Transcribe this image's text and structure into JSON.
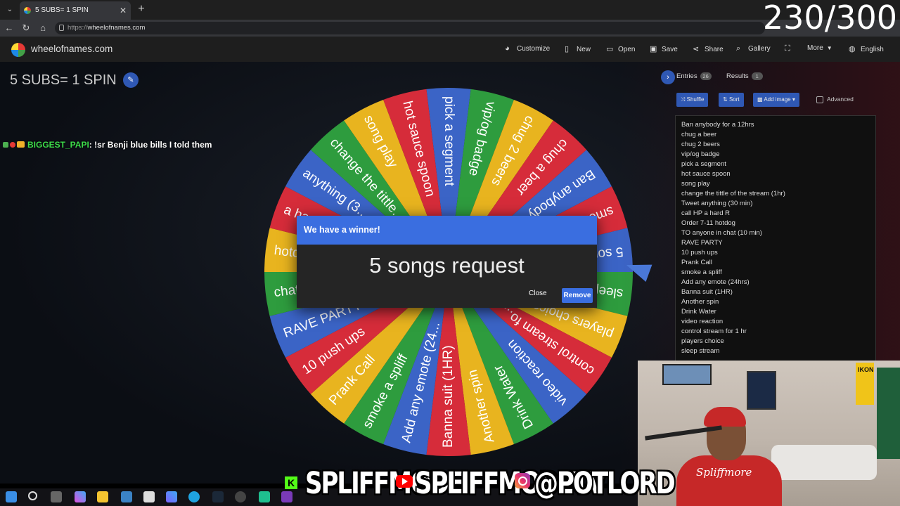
{
  "browser": {
    "tab_title": "5 SUBS= 1 SPIN",
    "tab_close": "✕",
    "new_tab": "+",
    "url_prefix": "https://",
    "url_host": "wheelofnames.com"
  },
  "stream_counter": "230/300",
  "site": {
    "name": "wheelofnames.com",
    "menu": [
      {
        "label": "Customize",
        "icon": "palette-icon"
      },
      {
        "label": "New",
        "icon": "new-file-icon"
      },
      {
        "label": "Open",
        "icon": "folder-icon"
      },
      {
        "label": "Save",
        "icon": "save-icon"
      },
      {
        "label": "Share",
        "icon": "share-icon"
      },
      {
        "label": "Gallery",
        "icon": "search-icon"
      },
      {
        "label": "",
        "icon": "fullscreen-icon"
      },
      {
        "label": "More",
        "icon": "chevron-down-icon"
      },
      {
        "label": "English",
        "icon": "globe-icon"
      }
    ]
  },
  "wheel": {
    "title": "5 SUBS= 1 SPIN",
    "segments": [
      {
        "label": "pick a segment",
        "color": "#3b64c6"
      },
      {
        "label": "vip/og badge",
        "color": "#2e9c3e"
      },
      {
        "label": "chug 2 beers",
        "color": "#e8b41f"
      },
      {
        "label": "chug a beer",
        "color": "#d62c3a"
      },
      {
        "label": "Ban anybody for a...",
        "color": "#3b64c6"
      },
      {
        "label": "smoke",
        "color": "#d62c3a"
      },
      {
        "label": "5 songs request",
        "color": "#3b64c6"
      },
      {
        "label": "sleep stream",
        "color": "#2e9c3e"
      },
      {
        "label": "players choice",
        "color": "#e8b41f"
      },
      {
        "label": "control stream fo...",
        "color": "#d62c3a"
      },
      {
        "label": "video reaction",
        "color": "#3b64c6"
      },
      {
        "label": "Drink Water",
        "color": "#2e9c3e"
      },
      {
        "label": "Another spin",
        "color": "#e8b41f"
      },
      {
        "label": "Banna suit (1HR)",
        "color": "#d62c3a"
      },
      {
        "label": "Add any emote (24...",
        "color": "#3b64c6"
      },
      {
        "label": "smoke a spliff",
        "color": "#2e9c3e"
      },
      {
        "label": "Prank Call",
        "color": "#e8b41f"
      },
      {
        "label": "10 push ups",
        "color": "#d62c3a"
      },
      {
        "label": "RAVE PARTY",
        "color": "#3b64c6"
      },
      {
        "label": "chat...",
        "color": "#2e9c3e"
      },
      {
        "label": "hotdog",
        "color": "#e8b41f"
      },
      {
        "label": "a hard R",
        "color": "#d62c3a"
      },
      {
        "label": "anything (3...",
        "color": "#3b64c6"
      },
      {
        "label": "change the tittle...",
        "color": "#2e9c3e"
      },
      {
        "label": "song play",
        "color": "#e8b41f"
      },
      {
        "label": "hot sauce spoon",
        "color": "#d62c3a"
      }
    ]
  },
  "chat": {
    "user": "BIGGEST_PAPI",
    "message": ": !sr Benji blue bills I told them"
  },
  "dialog": {
    "title": "We have a winner!",
    "winner": "5 songs request",
    "close_label": "Close",
    "remove_label": "Remove"
  },
  "panel": {
    "tab_entries": "Entries",
    "entries_count": "26",
    "tab_results": "Results",
    "results_count": "1",
    "shuffle_label": "Shuffle",
    "sort_label": "Sort",
    "add_image_label": "Add image",
    "advanced_label": "Advanced",
    "entries": [
      "Ban anybody for a 12hrs",
      "chug a beer",
      "chug 2 beers",
      "vip/og badge",
      "pick a segment",
      "hot sauce spoon",
      "song play",
      "change the tittle of the stream (1hr)",
      "Tweet anything (30 min)",
      "call HP a hard R",
      "Order 7-11 hotdog",
      "TO anyone in chat (10 min)",
      "RAVE PARTY",
      "10 push ups",
      "Prank Call",
      "smoke a spliff",
      "Add any emote (24hrs)",
      "Banna suit (1HR)",
      "Another spin",
      "Drink Water",
      "video reaction",
      "control stream for 1 hr",
      "players choice",
      "sleep stream"
    ]
  },
  "socials": {
    "kick_handle": "SPLIFFMODE",
    "youtube_handle": "SPLIFFMODETV",
    "instagram_handle": "@POTLORD"
  },
  "webcam": {
    "hoodie_text": "Spliffmore",
    "flag_text": "IKON"
  }
}
